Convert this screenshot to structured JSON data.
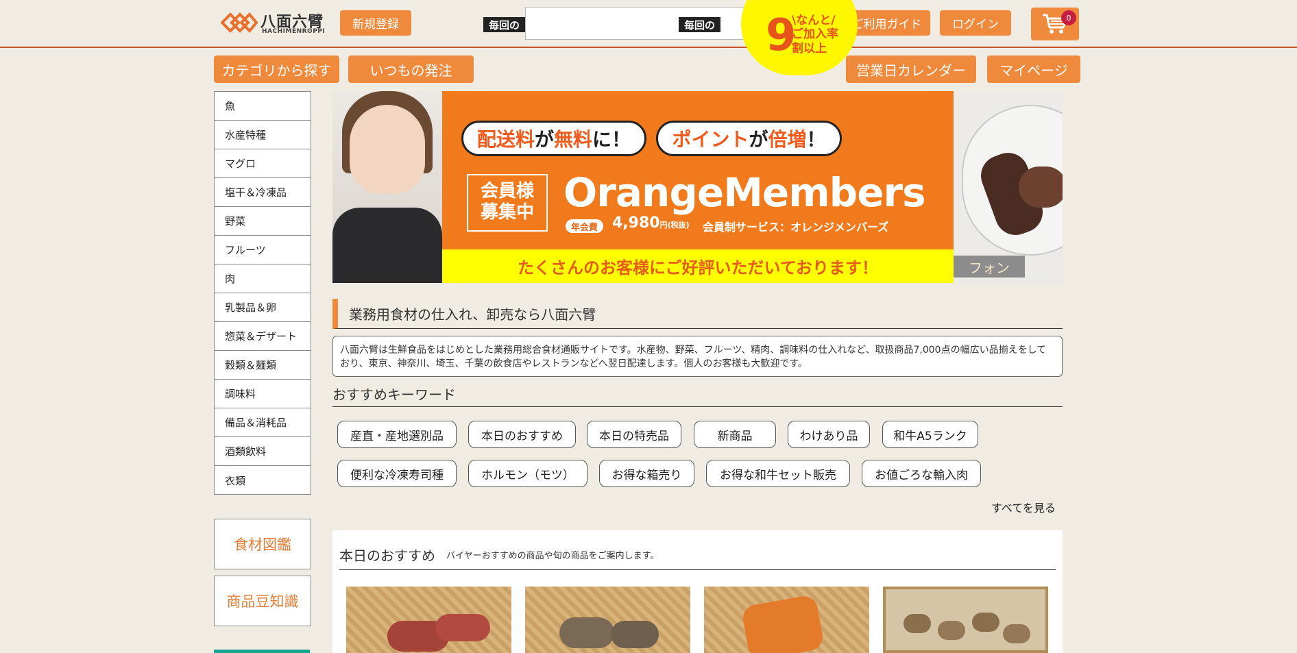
{
  "header": {
    "logo_jp": "八面六臂",
    "logo_en": "HACHIMENROPPI",
    "register_label": "新規登録",
    "search_placeholder": "",
    "guide_label": "ご利用ガイド",
    "guide_icon": "?",
    "login_label": "ログイン",
    "cart_count": "0"
  },
  "nav": {
    "category_label": "カテゴリから探す",
    "regular_order_label": "いつもの発注",
    "calendar_label": "営業日カレンダー",
    "mypage_label": "マイページ"
  },
  "sidebar": {
    "categories": [
      "魚",
      "水産特種",
      "マグロ",
      "塩干＆冷凍品",
      "野菜",
      "フルーツ",
      "肉",
      "乳製品＆卵",
      "惣菜＆デザート",
      "穀類＆麺類",
      "調味料",
      "備品＆消耗品",
      "酒類飲料",
      "衣類"
    ],
    "encyclopedia_label": "食材図鑑",
    "trivia_label": "商品豆知識"
  },
  "banner": {
    "tag1": "毎回の",
    "bubble1_hl1": "配送料",
    "bubble1_t1": "が",
    "bubble1_hl2": "無料",
    "bubble1_t2": "に！",
    "tag2": "毎回の",
    "bubble2_hl1": "ポイント",
    "bubble2_t1": "が",
    "bubble2_hl2": "倍増",
    "bubble2_t2": "！",
    "circle_num": "9",
    "circle_text": "\\なんと/\nご加入率\n割以上",
    "members_box": "会員様\n募集中",
    "members_title": "OrangeMembers",
    "fee_label": "年会費",
    "fee_amount": "4,980",
    "fee_unit": "円(税抜)",
    "members_sub": "会員制サービス：オレンジメンバーズ",
    "yellow_bar": "たくさんのお客様にご好評いただいております！",
    "right_label": "フォン"
  },
  "intro": {
    "title": "業務用食材の仕入れ、卸売なら八面六臂",
    "text": "八面六臂は生鮮食品をはじめとした業務用総合食材通販サイトです。水産物、野菜、フルーツ、精肉、調味料の仕入れなど、取扱商品7,000点の幅広い品揃えをしており、東京、神奈川、埼玉、千葉の飲食店やレストランなどへ翌日配達します。個人のお客様も大歓迎です。"
  },
  "keywords": {
    "title": "おすすめキーワード",
    "items": [
      "産直・産地選別品",
      "本日のおすすめ",
      "本日の特売品",
      "新商品",
      "わけあり品",
      "和牛A5ランク",
      "便利な冷凍寿司種",
      "ホルモン（モツ）",
      "お得な箱売り",
      "お得な和牛セット販売",
      "お値ごろな輸入肉"
    ],
    "see_all": "すべてを見る"
  },
  "recommend": {
    "title": "本日のおすすめ",
    "subtitle": "バイヤーおすすめの商品や旬の商品をご案内します。"
  },
  "colors": {
    "accent": "#ef8a3d",
    "header_line": "#c8502a",
    "background": "#f1ece3",
    "cart_badge": "#c71f3f",
    "side_green": "#16a58f"
  }
}
